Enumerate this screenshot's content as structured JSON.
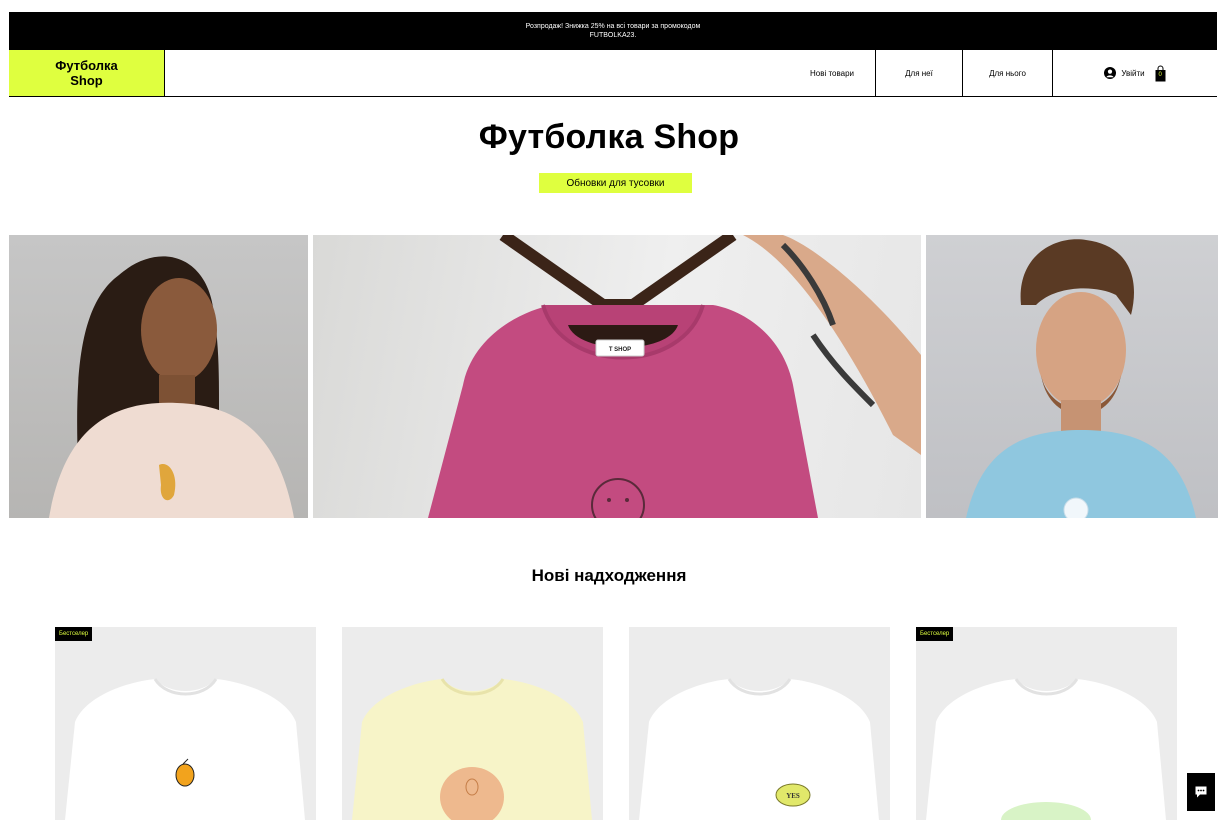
{
  "promo": {
    "line1": "Розпродаж! Знижка 25% на всі товари за промокодом",
    "line2": "FUTBOLKA23."
  },
  "header": {
    "logo_line1": "Футболка",
    "logo_line2": "Shop",
    "nav": [
      "Нові товари",
      "Для неї",
      "Для нього"
    ],
    "login_label": "Увійти",
    "cart_count": "0"
  },
  "hero": {
    "title": "Футболка Shop",
    "button_label": "Обновки для тусовки",
    "center_tag": "T SHOP"
  },
  "new_arrivals": {
    "title": "Нові надходження",
    "products": [
      {
        "badge": "Бестселер",
        "shirt_color": "#ffffff"
      },
      {
        "badge": "",
        "shirt_color": "#f7f4c8"
      },
      {
        "badge": "",
        "shirt_color": "#ffffff",
        "print_text": "YES"
      },
      {
        "badge": "Бестселер",
        "shirt_color": "#ffffff"
      }
    ]
  },
  "colors": {
    "accent": "#dfff3f",
    "promo_bg": "#000000"
  }
}
